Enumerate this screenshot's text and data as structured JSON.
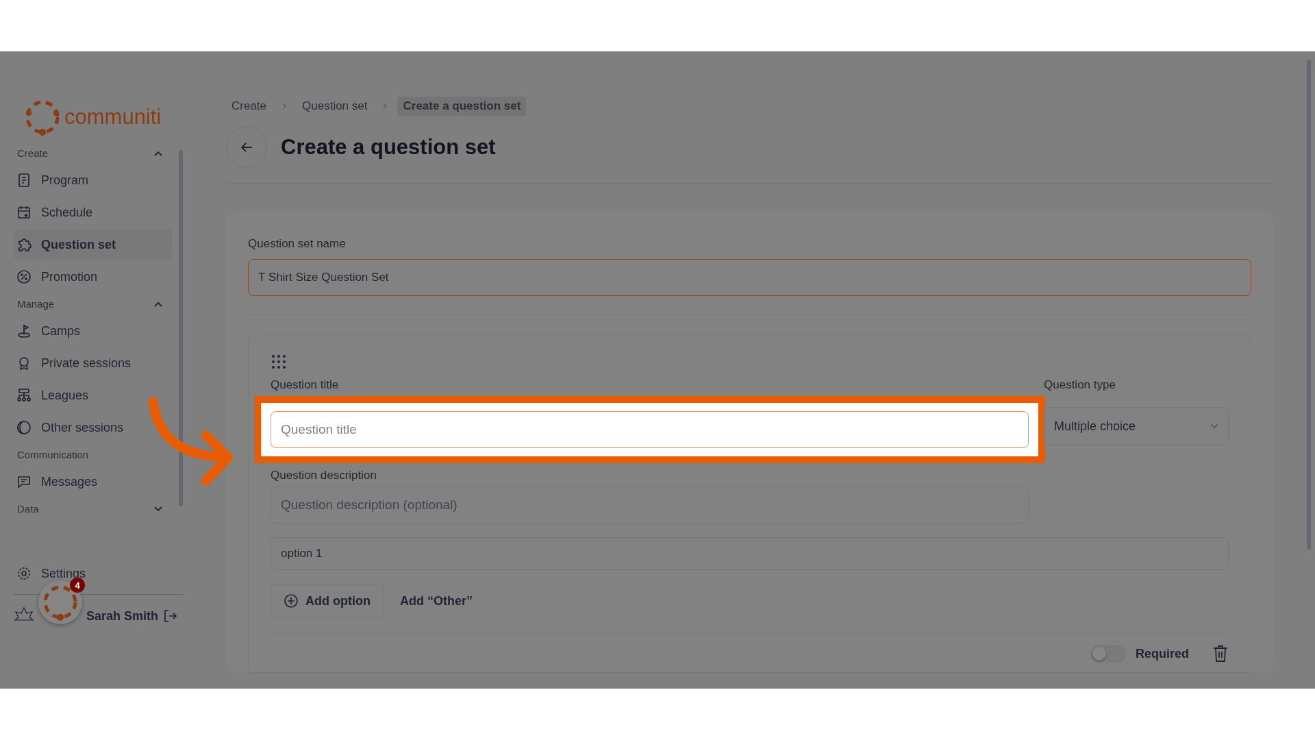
{
  "logo": {
    "text": "communiti"
  },
  "sidebar": {
    "sections": [
      {
        "title": "Create",
        "expanded": true,
        "items": [
          {
            "label": "Program",
            "selected": false
          },
          {
            "label": "Schedule",
            "selected": false
          },
          {
            "label": "Question set",
            "selected": true
          },
          {
            "label": "Promotion",
            "selected": false
          }
        ]
      },
      {
        "title": "Manage",
        "expanded": true,
        "items": [
          {
            "label": "Camps",
            "selected": false
          },
          {
            "label": "Private sessions",
            "selected": false
          },
          {
            "label": "Leagues",
            "selected": false
          },
          {
            "label": "Other sessions",
            "selected": false
          }
        ]
      },
      {
        "title": "Communication",
        "items": [
          {
            "label": "Messages",
            "selected": false
          }
        ]
      },
      {
        "title": "Data",
        "expanded": false
      }
    ],
    "settings": "Settings",
    "user": {
      "name": "Sarah Smith"
    },
    "notification_count": "4"
  },
  "breadcrumbs": [
    {
      "label": "Create",
      "selected": false
    },
    {
      "label": "Question set",
      "selected": false
    },
    {
      "label": "Create a question set",
      "selected": true
    }
  ],
  "page_title": "Create a question set",
  "form": {
    "name_label": "Question set name",
    "name_value": "T Shirt Size Question Set"
  },
  "question": {
    "title_label": "Question title",
    "title_placeholder": "Question title",
    "type_label": "Question type",
    "type_value": "Multiple choice",
    "description_label": "Question description",
    "description_placeholder": "Question description (optional)",
    "options": [
      "option 1"
    ],
    "add_option": "Add option",
    "add_other": "Add “Other”",
    "required_label": "Required",
    "required": false
  }
}
